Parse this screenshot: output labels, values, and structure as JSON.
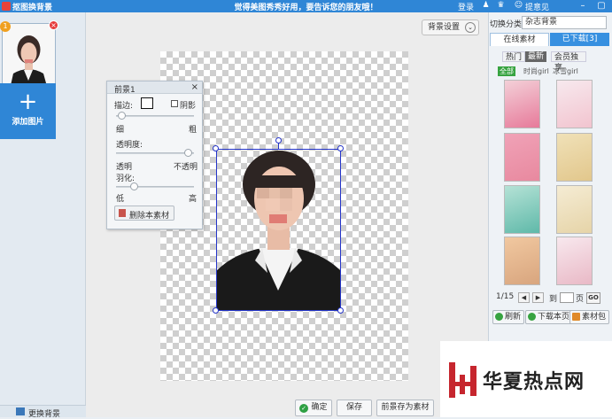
{
  "titlebar": {
    "app_title": "抠图换背景",
    "slogan": "觉得美图秀秀好用，要告诉您的朋友哦！",
    "login": "登录",
    "feedback": "提意见",
    "bg_color": "#2f86d6"
  },
  "left": {
    "thumb_number": "1",
    "add_label": "添加图片",
    "change_bg_label": "更换背景"
  },
  "toolbar": {
    "bg_settings": "背景设置"
  },
  "fg_panel": {
    "title": "前景1",
    "border_label": "描边:",
    "shadow_label": "阴影",
    "thin": "细",
    "thick": "粗",
    "opacity_label": "透明度:",
    "transparent": "透明",
    "opaque": "不透明",
    "feather_label": "羽化:",
    "low": "低",
    "high": "高",
    "delete_material": "删除本素材",
    "border_width_level": 0.02,
    "opacity_level": 0.97,
    "feather_level": 0.2
  },
  "right": {
    "category_label": "切换分类",
    "category_value": "杂志背景",
    "tab_online": "在线素材",
    "tab_downloaded": "已下载[3]",
    "sub_hot": "热门",
    "sub_new": "最新",
    "sub_vip": "会员独享",
    "tag_all": "全部",
    "tag_fashion": "时尚girl",
    "tag_ice": "冰雪girl",
    "page_indicator": "1/15",
    "goto_label": "到",
    "page_label": "页",
    "go_label": "GO",
    "refresh": "刷新",
    "download_page": "下载本页",
    "material_pack": "素材包",
    "accent": "#3790e0"
  },
  "bottom": {
    "confirm": "确定",
    "save": "保存",
    "save_fg_as_material": "前景存为素材"
  },
  "watermark": {
    "text": "华夏热点网",
    "color": "#c6262e"
  }
}
